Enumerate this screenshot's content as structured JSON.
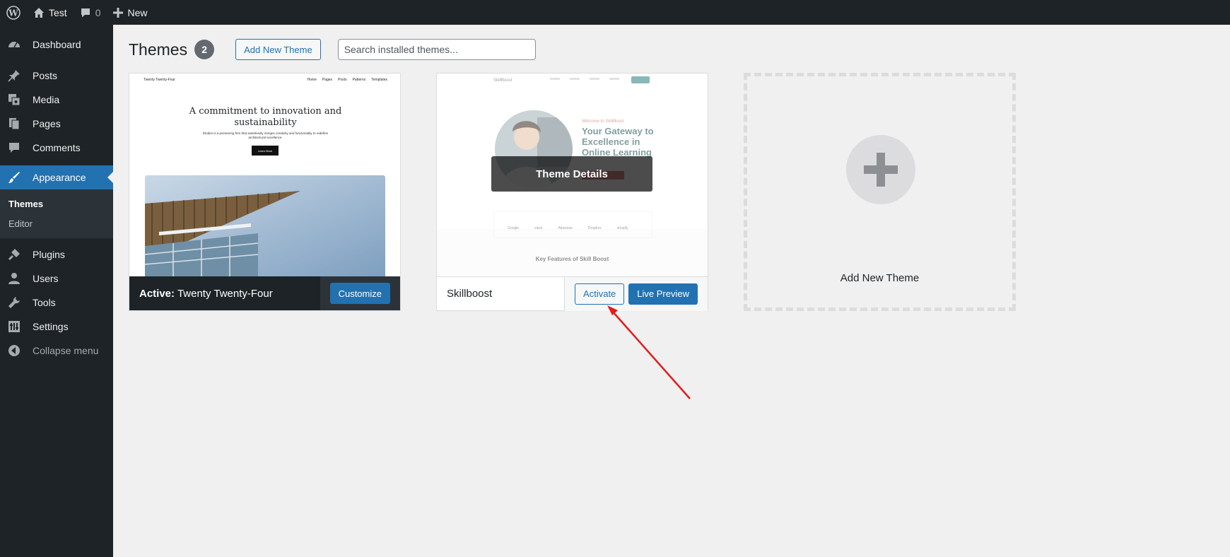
{
  "adminbar": {
    "site_name": "Test",
    "comments_count": "0",
    "new_label": "New"
  },
  "sidebar": {
    "items": [
      {
        "label": "Dashboard",
        "icon": "dashboard-icon"
      },
      {
        "label": "Posts",
        "icon": "pin-icon"
      },
      {
        "label": "Media",
        "icon": "media-icon"
      },
      {
        "label": "Pages",
        "icon": "pages-icon"
      },
      {
        "label": "Comments",
        "icon": "comment-icon"
      },
      {
        "label": "Appearance",
        "icon": "brush-icon"
      },
      {
        "label": "Plugins",
        "icon": "plug-icon"
      },
      {
        "label": "Users",
        "icon": "user-icon"
      },
      {
        "label": "Tools",
        "icon": "wrench-icon"
      },
      {
        "label": "Settings",
        "icon": "settings-icon"
      },
      {
        "label": "Collapse menu",
        "icon": "collapse-icon"
      }
    ],
    "submenu": [
      "Themes",
      "Editor"
    ]
  },
  "header": {
    "title": "Themes",
    "count": "2",
    "add_new_label": "Add New Theme",
    "search_placeholder": "Search installed themes..."
  },
  "themes": [
    {
      "active_prefix": "Active:",
      "name": "Twenty Twenty-Four",
      "action": "Customize",
      "preview": {
        "site_title": "Twenty Twenty-Four",
        "nav": [
          "Home",
          "Pages",
          "Posts",
          "Patterns",
          "Templates"
        ],
        "hero_heading": "A commitment to innovation and sustainability",
        "hero_text": "Études is a pioneering firm that seamlessly merges creativity and functionality to redefine architectural excellence.",
        "hero_button": "Learn More"
      }
    },
    {
      "name": "Skillboost",
      "activate_label": "Activate",
      "live_preview_label": "Live Preview",
      "details_label": "Theme Details",
      "preview": {
        "logo": "SkillBoost",
        "tagline": "Welcome to SkillBoost",
        "heading": "Your Gateway to Excellence in Online Learning",
        "features_heading": "Key Features of Skill Boost",
        "companies": [
          "Google",
          "slack",
          "Atlassian",
          "Dropbox",
          "shopify"
        ]
      }
    }
  ],
  "add_new_theme_label": "Add New Theme",
  "colors": {
    "admin_dark": "#1d2327",
    "accent": "#2271b1",
    "annotation_arrow": "#e31b1b"
  }
}
